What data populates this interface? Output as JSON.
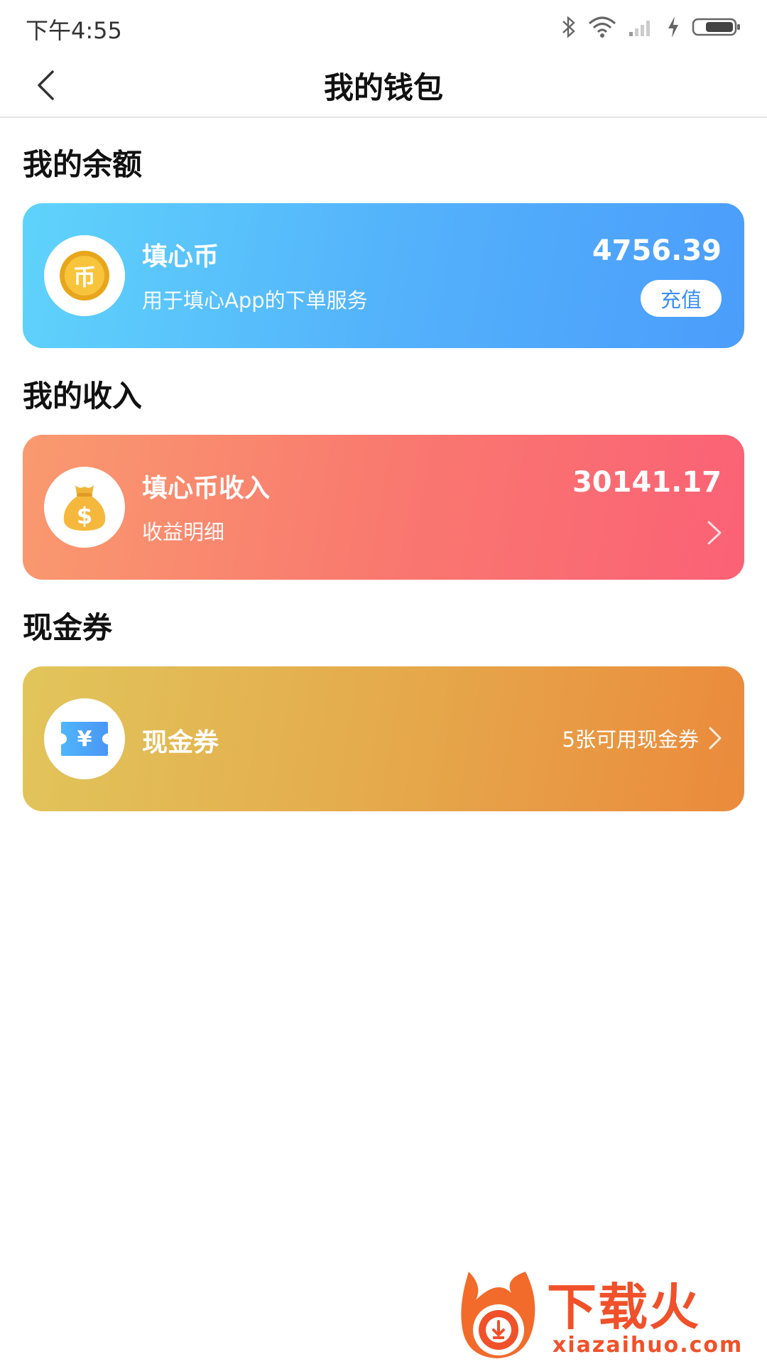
{
  "status_bar": {
    "time": "下午4:55",
    "icons": [
      "bluetooth-icon",
      "wifi-icon",
      "signal-icon",
      "charging-icon",
      "battery-icon"
    ]
  },
  "nav": {
    "back_icon": "chevron-left-icon",
    "title": "我的钱包"
  },
  "balance_section": {
    "title": "我的余额",
    "card": {
      "icon": "coin-icon",
      "icon_glyph": "币",
      "name": "填心币",
      "description": "用于填心App的下单服务",
      "amount": "4756.39",
      "action_label": "充值"
    }
  },
  "income_section": {
    "title": "我的收入",
    "card": {
      "icon": "money-bag-icon",
      "name": "填心币收入",
      "description": "收益明细",
      "amount": "30141.17"
    }
  },
  "coupon_section": {
    "title": "现金券",
    "card": {
      "icon": "ticket-icon",
      "icon_glyph": "¥",
      "name": "现金券",
      "count_text": "5张可用现金券"
    }
  },
  "watermark": {
    "text": "下载火",
    "url": "xiazaihuo.com"
  },
  "colors": {
    "balance_gradient": [
      "#5fd3fb",
      "#4b9dfb"
    ],
    "income_gradient": [
      "#f99a6f",
      "#fb6176"
    ],
    "coupon_gradient": [
      "#e1c55b",
      "#eb8a3c"
    ],
    "accent_blue": "#3d8ef5",
    "watermark_orange": "#f0512a"
  }
}
